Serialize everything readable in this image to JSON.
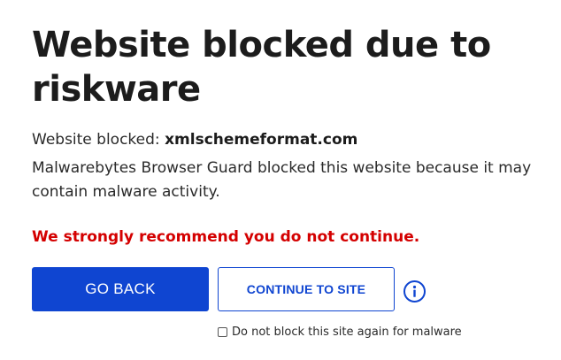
{
  "heading": {
    "title": "Website blocked due to riskware"
  },
  "details": {
    "blocked_label": "Website blocked:",
    "blocked_domain": "xmlschemeformat.com",
    "explanation": "Malwarebytes Browser Guard blocked this website because it may contain malware activity."
  },
  "warning": {
    "text": "We strongly recommend you do not continue.",
    "color": "#d40000"
  },
  "actions": {
    "go_back_label": "GO BACK",
    "continue_label": "CONTINUE TO SITE",
    "info_icon": "info-circle-icon",
    "accent_color": "#0f45d1"
  },
  "option": {
    "checkbox_label": "Do not block this site again for malware",
    "checked": false
  }
}
